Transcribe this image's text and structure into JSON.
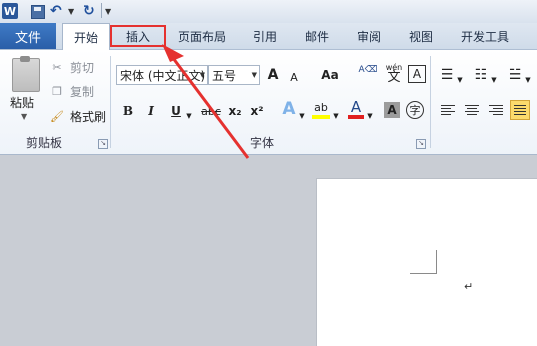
{
  "quick_access": {
    "app_icon_label": "W"
  },
  "tabs": {
    "file": "文件",
    "items": [
      "开始",
      "插入",
      "页面布局",
      "引用",
      "邮件",
      "审阅",
      "视图",
      "开发工具"
    ]
  },
  "clipboard": {
    "paste": "粘贴",
    "cut": "剪切",
    "copy": "复制",
    "format_painter": "格式刷",
    "group_label": "剪贴板"
  },
  "font": {
    "font_name": "宋体 (中文正文)",
    "font_size": "五号",
    "grow_label": "A",
    "shrink_label": "A",
    "case_label": "Aa",
    "bold": "B",
    "italic": "I",
    "underline": "U",
    "strike": "abc",
    "subscript": "x₂",
    "superscript": "x²",
    "text_effect": "A",
    "highlight": "ab",
    "font_color": "A",
    "char_shading": "A",
    "enclose": "字",
    "phonetic_top": "wén",
    "phonetic_char": "文",
    "char_border": "A",
    "group_label": "字体"
  },
  "document": {
    "paragraph_mark": "↵"
  },
  "colors": {
    "annotation": "#e5312f",
    "file_tab": "#2a5ea8",
    "highlight": "#ffff00",
    "font_color": "#e02020"
  }
}
